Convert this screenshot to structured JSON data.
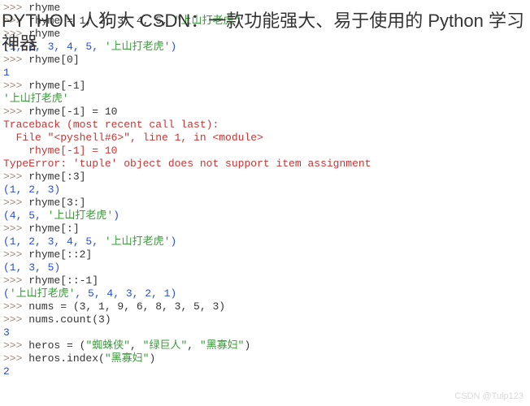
{
  "overlay": {
    "title": "PYTHON 人狗大 CSDN：一款功能强大、易于使用的 Python 学习神器"
  },
  "watermark": "CSDN @Tulp123",
  "prompt": ">>> ",
  "lines": [
    {
      "type": "in",
      "text": "rhyme"
    },
    {
      "type": "in",
      "seg": [
        {
          "t": "rhyme = 1, 2, 3, 4, 5, ",
          "c": "code"
        },
        {
          "t": "\"上山打老虎\"",
          "c": "str-dq"
        }
      ]
    },
    {
      "type": "in",
      "text": "rhyme"
    },
    {
      "type": "out",
      "seg": [
        {
          "t": "(1, 2, 3, 4, 5, ",
          "c": "out-blue"
        },
        {
          "t": "'上山打老虎'",
          "c": "str-sq"
        },
        {
          "t": ")",
          "c": "out-blue"
        }
      ]
    },
    {
      "type": "in",
      "text": "rhyme[0]"
    },
    {
      "type": "out",
      "seg": [
        {
          "t": "1",
          "c": "out-num"
        }
      ]
    },
    {
      "type": "in",
      "text": "rhyme[-1]"
    },
    {
      "type": "out",
      "seg": [
        {
          "t": "'上山打老虎'",
          "c": "str-sq"
        }
      ]
    },
    {
      "type": "in",
      "text": "rhyme[-1] = 10"
    },
    {
      "type": "err",
      "text": "Traceback (most recent call last):"
    },
    {
      "type": "err",
      "text": "  File \"<pyshell#6>\", line 1, in <module>"
    },
    {
      "type": "err",
      "text": "    rhyme[-1] = 10"
    },
    {
      "type": "err",
      "text": "TypeError: 'tuple' object does not support item assignment"
    },
    {
      "type": "in",
      "text": "rhyme[:3]"
    },
    {
      "type": "out",
      "seg": [
        {
          "t": "(1, 2, 3)",
          "c": "out-blue"
        }
      ]
    },
    {
      "type": "in",
      "text": "rhyme[3:]"
    },
    {
      "type": "out",
      "seg": [
        {
          "t": "(4, 5, ",
          "c": "out-blue"
        },
        {
          "t": "'上山打老虎'",
          "c": "str-sq"
        },
        {
          "t": ")",
          "c": "out-blue"
        }
      ]
    },
    {
      "type": "in",
      "text": "rhyme[:]"
    },
    {
      "type": "out",
      "seg": [
        {
          "t": "(1, 2, 3, 4, 5, ",
          "c": "out-blue"
        },
        {
          "t": "'上山打老虎'",
          "c": "str-sq"
        },
        {
          "t": ")",
          "c": "out-blue"
        }
      ]
    },
    {
      "type": "in",
      "text": "rhyme[::2]"
    },
    {
      "type": "out",
      "seg": [
        {
          "t": "(1, 3, 5)",
          "c": "out-blue"
        }
      ]
    },
    {
      "type": "in",
      "text": "rhyme[::-1]"
    },
    {
      "type": "out",
      "seg": [
        {
          "t": "(",
          "c": "out-blue"
        },
        {
          "t": "'上山打老虎'",
          "c": "str-sq"
        },
        {
          "t": ", 5, 4, 3, 2, 1)",
          "c": "out-blue"
        }
      ]
    },
    {
      "type": "in",
      "text": "nums = (3, 1, 9, 6, 8, 3, 5, 3)"
    },
    {
      "type": "in",
      "text": "nums.count(3)"
    },
    {
      "type": "out",
      "seg": [
        {
          "t": "3",
          "c": "out-num"
        }
      ]
    },
    {
      "type": "in",
      "seg": [
        {
          "t": "heros = (",
          "c": "code"
        },
        {
          "t": "\"蜘蛛侠\"",
          "c": "str-dq"
        },
        {
          "t": ", ",
          "c": "code"
        },
        {
          "t": "\"绿巨人\"",
          "c": "str-dq"
        },
        {
          "t": ", ",
          "c": "code"
        },
        {
          "t": "\"黑寡妇\"",
          "c": "str-dq"
        },
        {
          "t": ")",
          "c": "code"
        }
      ]
    },
    {
      "type": "in",
      "seg": [
        {
          "t": "heros.index(",
          "c": "code"
        },
        {
          "t": "\"黑寡妇\"",
          "c": "str-dq"
        },
        {
          "t": ")",
          "c": "code"
        }
      ]
    },
    {
      "type": "out",
      "seg": [
        {
          "t": "2",
          "c": "out-num"
        }
      ]
    }
  ]
}
